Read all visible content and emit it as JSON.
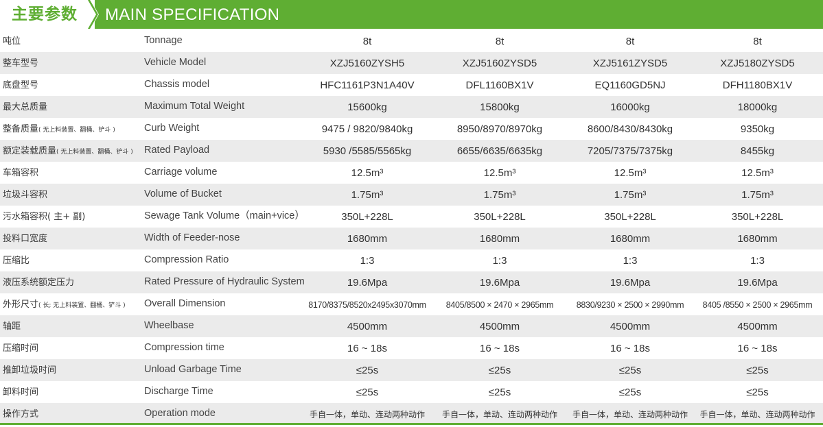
{
  "header": {
    "title_cn": "主要参数",
    "title_en": "MAIN SPECIFICATION",
    "accent_color": "#5fae33"
  },
  "rows": [
    {
      "cn": "吨位",
      "note": "",
      "en": "Tonnage",
      "values": [
        "8t",
        "8t",
        "8t",
        "8t"
      ]
    },
    {
      "cn": "整车型号",
      "note": "",
      "en": "Vehicle Model",
      "values": [
        "XZJ5160ZYSH5",
        "XZJ5160ZYSD5",
        "XZJ5161ZYSD5",
        "XZJ5180ZYSD5"
      ]
    },
    {
      "cn": "底盘型号",
      "note": "",
      "en": "Chassis model",
      "values": [
        "HFC1161P3N1A40V",
        "DFL1160BX1V",
        "EQ1160GD5NJ",
        "DFH1180BX1V"
      ]
    },
    {
      "cn": "最大总质量",
      "note": "",
      "en": "Maximum Total Weight",
      "values": [
        "15600kg",
        "15800kg",
        "16000kg",
        "18000kg"
      ]
    },
    {
      "cn": "整备质量",
      "note": "( 无上料装置、翻桶、铲斗 )",
      "en": "Curb Weight",
      "values": [
        "9475 / 9820/9840kg",
        "8950/8970/8970kg",
        "8600/8430/8430kg",
        "9350kg"
      ]
    },
    {
      "cn": "额定装载质量",
      "note": "( 无上料装置、翻桶、铲斗 )",
      "en": "Rated Payload",
      "values": [
        "5930 /5585/5565kg",
        "6655/6635/6635kg",
        "7205/7375/7375kg",
        "8455kg"
      ]
    },
    {
      "cn": "车箱容积",
      "note": "",
      "en": "Carriage volume",
      "values": [
        "12.5m³",
        "12.5m³",
        "12.5m³",
        "12.5m³"
      ]
    },
    {
      "cn": "垃圾斗容积",
      "note": "",
      "en": "Volume of  Bucket",
      "values": [
        "1.75m³",
        "1.75m³",
        "1.75m³",
        "1.75m³"
      ]
    },
    {
      "cn": "污水箱容积( 主+ 副)",
      "note": "",
      "en": "Sewage Tank Volume（main+vice）",
      "values": [
        "350L+228L",
        "350L+228L",
        "350L+228L",
        "350L+228L"
      ]
    },
    {
      "cn": "投料口宽度",
      "note": "",
      "en": "Width of  Feeder-nose",
      "values": [
        "1680mm",
        "1680mm",
        "1680mm",
        "1680mm"
      ]
    },
    {
      "cn": "压缩比",
      "note": "",
      "en": "Compression Ratio",
      "values": [
        "1:3",
        "1:3",
        "1:3",
        "1:3"
      ]
    },
    {
      "cn": "液压系统额定压力",
      "note": "",
      "en": "Rated Pressure of Hydraulic System",
      "values": [
        "19.6Mpa",
        "19.6Mpa",
        "19.6Mpa",
        "19.6Mpa"
      ]
    },
    {
      "cn": "外形尺寸",
      "note": "( 长; 无上料装置、翻桶、铲斗 )",
      "en": "Overall Dimension",
      "values": [
        "8170/8375/8520x2495x3070mm",
        "8405/8500 × 2470 × 2965mm",
        "8830/9230 × 2500 × 2990mm",
        "8405 /8550 × 2500 × 2965mm"
      ],
      "small": true
    },
    {
      "cn": "轴距",
      "note": "",
      "en": "Wheelbase",
      "values": [
        "4500mm",
        "4500mm",
        "4500mm",
        "4500mm"
      ]
    },
    {
      "cn": "压缩时间",
      "note": "",
      "en": "Compression time",
      "values": [
        "16 ~ 18s",
        "16 ~ 18s",
        "16 ~ 18s",
        "16 ~ 18s"
      ]
    },
    {
      "cn": "推卸垃圾时间",
      "note": "",
      "en": "Unload Garbage Time",
      "values": [
        "≤25s",
        "≤25s",
        "≤25s",
        "≤25s"
      ]
    },
    {
      "cn": "卸料时间",
      "note": "",
      "en": "Discharge Time",
      "values": [
        "≤25s",
        "≤25s",
        "≤25s",
        "≤25s"
      ]
    },
    {
      "cn": "操作方式",
      "note": "",
      "en": "Operation mode",
      "values": [
        "手自一体，单动、连动两种动作",
        "手自一体，单动、连动两种动作",
        "手自一体，单动、连动两种动作",
        "手自一体，单动、连动两种动作"
      ],
      "cnval": true
    }
  ]
}
